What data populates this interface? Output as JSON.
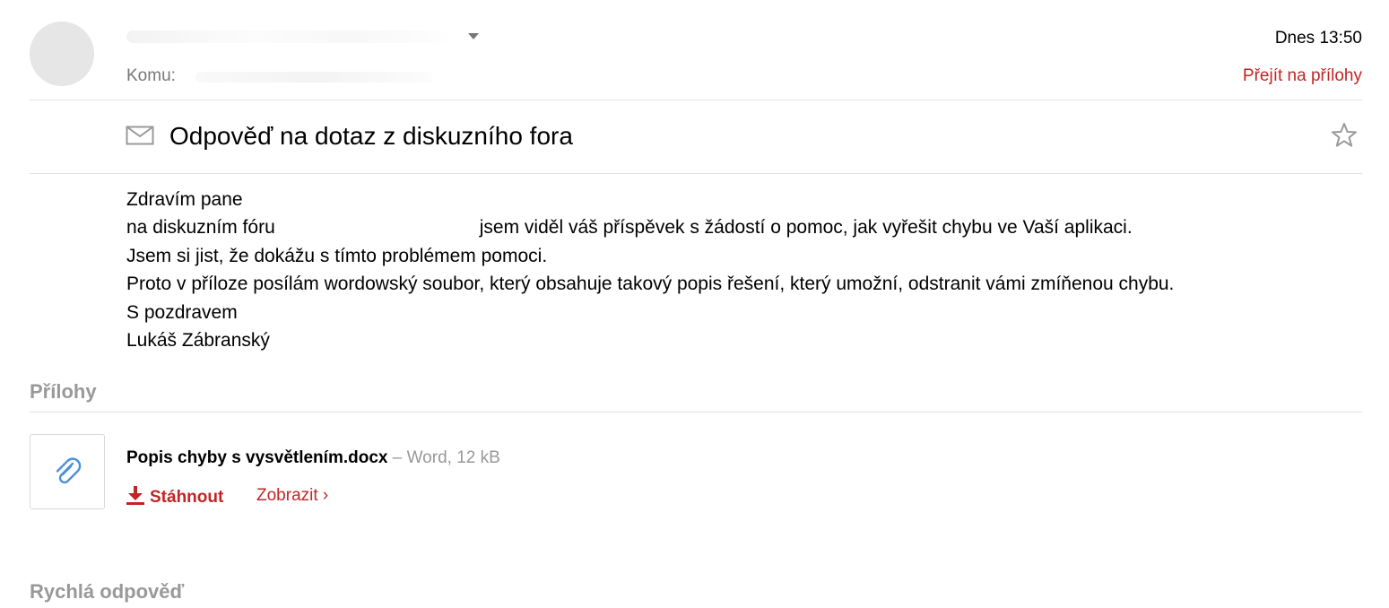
{
  "header": {
    "date": "Dnes 13:50",
    "to_label": "Komu:",
    "goto_attachments": "Přejít na přílohy"
  },
  "message": {
    "subject": "Odpověď na dotaz z diskuzního fora",
    "body": {
      "greeting": "Zdravím pane",
      "line2_a": "na diskuzním fóru",
      "line2_b": "jsem viděl váš příspěvek s žádostí o pomoc, jak vyřešit chybu ve Vaší aplikaci.",
      "line3": "Jsem si jist, že dokážu s tímto problémem pomoci.",
      "line4": "Proto v příloze posílám wordowský soubor, který obsahuje takový popis řešení, který umožní, odstranit vámi zmíňenou chybu.",
      "closing": "S pozdravem",
      "signature": "Lukáš Zábranský"
    }
  },
  "attachments": {
    "title": "Přílohy",
    "items": [
      {
        "name": "Popis chyby s vysvětlením.docx",
        "meta": " – Word, 12 kB",
        "download_label": "Stáhnout",
        "view_label": "Zobrazit ›"
      }
    ]
  },
  "quick_reply": {
    "title": "Rychlá odpověď"
  },
  "icons": {
    "envelope": "envelope-icon",
    "star": "star-icon",
    "attachment": "paperclip-icon",
    "download": "download-icon",
    "sender_dropdown": "chevron-down-icon"
  },
  "colors": {
    "accent": "#c12525",
    "muted": "#777777",
    "section_title": "#999999",
    "paperclip": "#4a90d9"
  }
}
